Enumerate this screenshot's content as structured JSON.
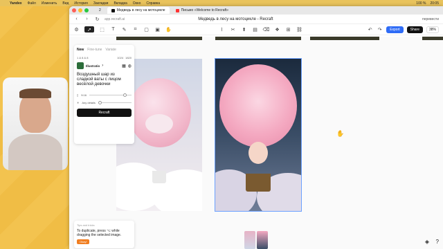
{
  "menubar": {
    "items": [
      "Yandex",
      "Файл",
      "Изменить",
      "Вид",
      "История",
      "Закладки",
      "Вкладка",
      "Окно",
      "Справка"
    ],
    "right": [
      "100 %",
      "20:05"
    ]
  },
  "browser": {
    "tabs": [
      {
        "label": "2"
      },
      {
        "label": "Медведь в лесу на мотоцикле"
      },
      {
        "label": "Письмо «Welcome to Recraft»"
      }
    ],
    "url": "app.recraft.ai",
    "page_title": "Медведь в лесу на мотоцикле - Recraft",
    "translate_label": "перевести"
  },
  "toolbar": {
    "export_label": "Export",
    "share_label": "Share",
    "zoom": "38%"
  },
  "panel": {
    "tabs": [
      "New",
      "Fine-tune",
      "Variate"
    ],
    "counter": "1 & 8 & 8",
    "size_a": "1024",
    "size_b": "1820",
    "style_label": "Illustratio",
    "prompt": "Воздушный шар из сладкой ваты с лицом весёлой девочки",
    "ratio_label": "9:16",
    "details_label": "Any details",
    "generate_label": "Recraft"
  },
  "tips": {
    "heading": "Tips and tricks",
    "text": "To duplicate, press ⌥ while dragging the selected image.",
    "ok_label": "Okay!"
  },
  "colors": {
    "accent": "#2f6cf6",
    "orange": "#f07d20"
  }
}
